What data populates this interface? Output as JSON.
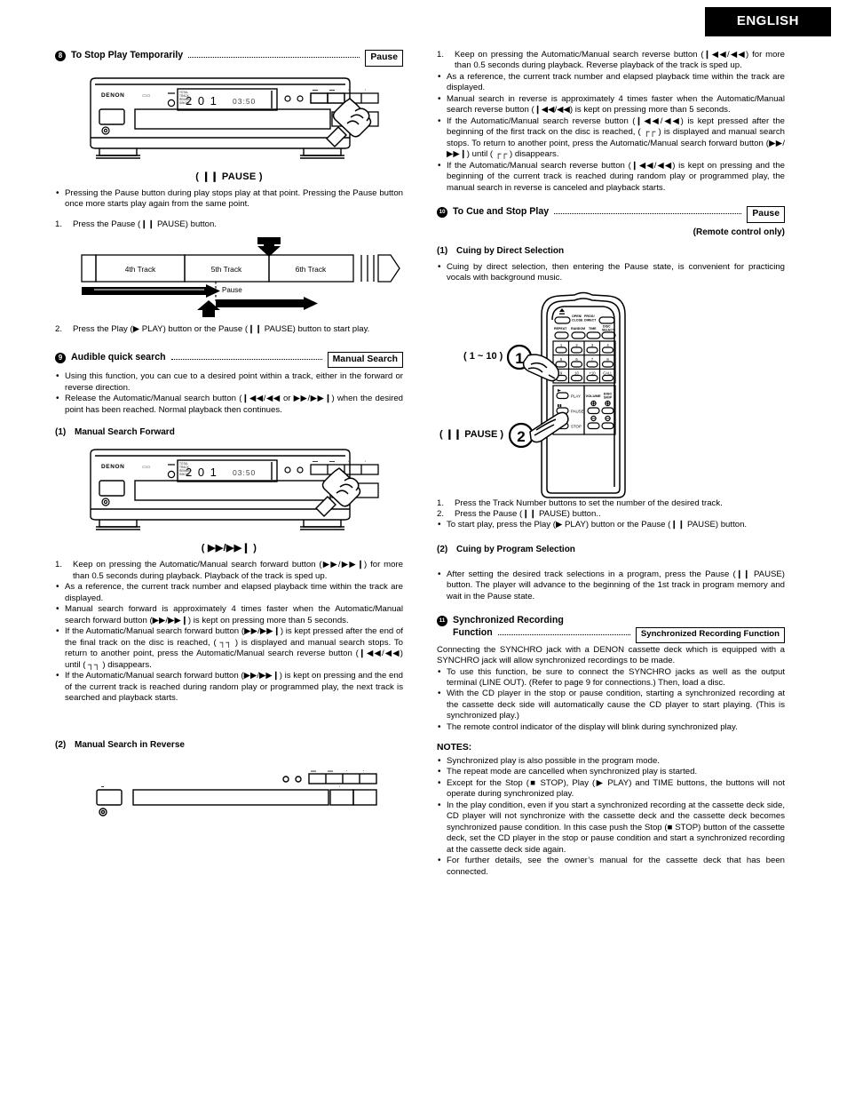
{
  "header": {
    "language_tab": "ENGLISH"
  },
  "left_column": {
    "section8": {
      "number": "8",
      "title": "To Stop Play Temporarily",
      "keyword": "Pause",
      "illustration": {
        "name": "cd-player-front-panel",
        "brand": "DENON",
        "display_track": "2 0 1",
        "display_time": "03:50",
        "caption": "( ❙❙ PAUSE )"
      },
      "bullets": [
        "Pressing the Pause button during play stops play at that point. Pressing the Pause button once more starts play again from the same point."
      ],
      "steps": [
        {
          "n": "1.",
          "text": "Press the Pause (❙❙ PAUSE) button."
        },
        {
          "n": "2.",
          "text": "Press the Play (▶ PLAY) button or the Pause (❙❙ PAUSE) button to start play."
        }
      ],
      "track_diagram": {
        "name": "track-timeline-diagram",
        "tracks": [
          "4th Track",
          "5th Track",
          "6th Track"
        ],
        "pause_label": "Pause"
      }
    },
    "section9": {
      "number": "9",
      "title": "Audible quick search",
      "keyword": "Manual Search",
      "bullets": [
        "Using this function, you can cue to a desired point within a track, either in the forward or reverse direction.",
        "Release the Automatic/Manual search button (❙◀◀/◀◀ or ▶▶/▶▶❙) when the desired point has been reached. Normal playback then continues."
      ],
      "sub1": {
        "index": "(1)",
        "title": "Manual Search Forward",
        "illustration": {
          "name": "cd-player-front-panel",
          "brand": "DENON",
          "display_track": "2 0 1",
          "display_time": "03:50",
          "caption": "( ▶▶/▶▶❙ )"
        },
        "steps": [
          {
            "n": "1.",
            "text": "Keep on pressing the Automatic/Manual search forward button (▶▶/▶▶❙) for more than 0.5 seconds during playback. Playback of the track is sped up."
          }
        ],
        "bullets": [
          "As a reference, the current track number and elapsed playback time within the track are displayed.",
          "Manual search forward is approximately 4 times faster when the Automatic/Manual search forward button (▶▶/▶▶❙) is kept on pressing more than 5 seconds.",
          "If the Automatic/Manual search forward button (▶▶/▶▶❙) is kept pressed after the end of the final track on the disc is reached, ( ┐┐ ) is displayed and manual search stops. To return to another point, press the Automatic/Manual search reverse button (❙◀◀/◀◀) until ( ┐┐ ) disappears.",
          "If the Automatic/Manual search forward button (▶▶/▶▶❙) is kept on pressing and the end of the current track is reached during random play or programmed play, the next track is searched and playback starts."
        ]
      },
      "sub2": {
        "index": "(2)",
        "title": "Manual Search in Reverse",
        "illustration": {
          "name": "cd-player-front-panel-partial"
        }
      }
    }
  },
  "right_column": {
    "reverse_search": {
      "steps": [
        {
          "n": "1.",
          "text": "Keep on pressing the Automatic/Manual search reverse button (❙◀◀/◀◀) for more than 0.5 seconds during playback. Reverse playback of the track is sped up."
        }
      ],
      "bullets": [
        "As a reference, the current track number and elapsed playback time within the track are displayed.",
        "Manual search in reverse is approximately 4 times faster when the Automatic/Manual search reverse button (❙◀◀/◀◀) is kept on pressing more than 5 seconds.",
        "If the Automatic/Manual search reverse button (❙◀◀/◀◀) is kept pressed after the beginning of the first track on the disc is reached, ( ┌┌ ) is displayed and manual search stops. To return to another point, press the Automatic/Manual search forward button (▶▶/▶▶❙) until ( ┌┌ ) disappears.",
        "If the Automatic/Manual search reverse button (❙◀◀/◀◀) is kept on pressing and the beginning of the current track is reached during random play or programmed play, the manual search in reverse is canceled and playback starts."
      ]
    },
    "section10": {
      "number": "10",
      "title": "To Cue and Stop Play",
      "keyword": "Pause",
      "subnote": "(Remote control only)",
      "sub1": {
        "index": "(1)",
        "title": "Cuing by Direct Selection",
        "bullets": [
          "Cuing by direct selection, then entering the Pause state, is convenient for practicing vocals with background music."
        ],
        "remote": {
          "name": "remote-control",
          "callout1_label": "( 1 ~ 10 )",
          "callout1_number": "1",
          "callout2_label": "( ❙❙ PAUSE )",
          "callout2_number": "2",
          "top_row": [
            "OPEN/",
            "CLOSE",
            "PROG/",
            "DIRECT"
          ],
          "func_row": [
            "REPEAT",
            "RANDOM",
            "TIME",
            "DISC SELECT"
          ],
          "keypad": [
            "1",
            "2",
            "3",
            "4",
            "5",
            "6",
            "7",
            "8",
            "9",
            "10",
            "+10",
            "CALL"
          ],
          "transport": [
            "PLAY",
            "PAUSE",
            "STOP"
          ],
          "right_labels": [
            "VOLUME",
            "DISC SKIP"
          ]
        },
        "steps": [
          {
            "n": "1.",
            "text": "Press the Track Number buttons to set the number of the desired track."
          },
          {
            "n": "2.",
            "text": "Press the Pause (❙❙ PAUSE) button.."
          }
        ],
        "bullets2": [
          "To start play, press the Play (▶ PLAY) button or the Pause (❙❙ PAUSE) button."
        ]
      },
      "sub2": {
        "index": "(2)",
        "title": "Cuing by Program Selection",
        "bullets": [
          "After setting the desired track selections in a program, press the Pause (❙❙ PAUSE) button. The player will advance to the beginning of the 1st track in program memory and wait in the Pause state."
        ]
      }
    },
    "section11": {
      "number": "11",
      "title_line1": "Synchronized Recording",
      "title_line2": "Function",
      "keyword": "Synchronized Recording Function",
      "intro": "Connecting the SYNCHRO jack with a DENON cassette deck which is equipped with a SYNCHRO jack will allow synchronized recordings to be made.",
      "bullets": [
        "To use this function, be sure to connect the SYNCHRO jacks as well as the output terminal (LINE OUT). (Refer to page 9 for connections.) Then, load a disc.",
        "With the CD player in the stop or pause condition, starting a synchronized recording at the cassette deck side will automatically cause the CD player to start playing. (This is synchronized play.)",
        "The remote control indicator of the display will blink during synchronized play."
      ],
      "notes_title": "NOTES:",
      "notes": [
        "Synchronized play is also possible in the program mode.",
        "The repeat mode are cancelled when synchronized play is started.",
        "Except for the Stop (■ STOP), Play (▶ PLAY) and TIME buttons, the buttons will not operate during synchronized play.",
        "In the play condition, even if you start a synchronized recording at the cassette deck side, CD player will not synchronize with the cassette deck and the cassette deck becomes synchronized pause condition. In this case push the Stop (■ STOP) button of the cassette deck, set the CD player in the stop or pause condition and start a synchronized recording at the cassette deck side again.",
        "For further details, see the owner’s manual for the cassette deck that has been connected."
      ]
    }
  },
  "colors": {
    "ink": "#000000",
    "paper": "#ffffff",
    "tab_bg": "#000000",
    "tab_fg": "#ffffff"
  }
}
